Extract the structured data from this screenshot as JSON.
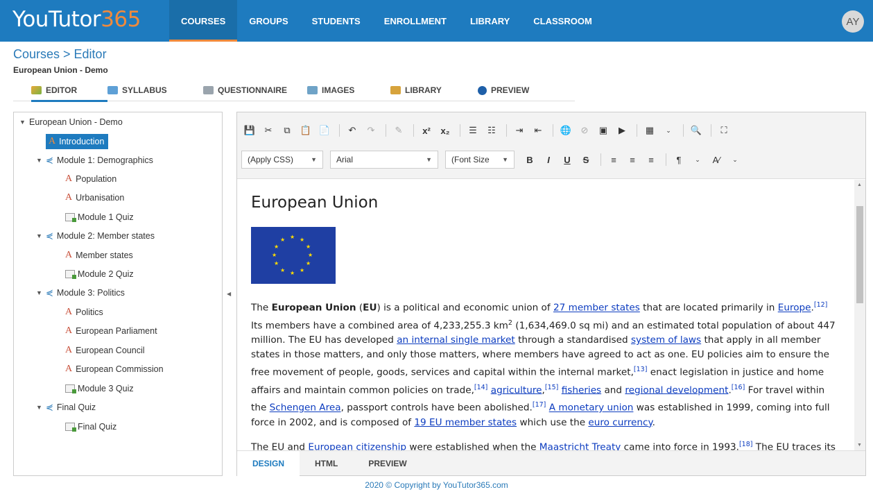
{
  "app": {
    "logo_main": "YouTutor",
    "logo_accent": "365",
    "avatar_initials": "AY"
  },
  "nav": [
    {
      "label": "COURSES"
    },
    {
      "label": "GROUPS"
    },
    {
      "label": "STUDENTS"
    },
    {
      "label": "ENROLLMENT"
    },
    {
      "label": "LIBRARY"
    },
    {
      "label": "CLASSROOM"
    }
  ],
  "breadcrumb": "Courses > Editor",
  "course_title": "European Union - Demo",
  "tabs": [
    {
      "label": "EDITOR",
      "icon": "pencil-icon"
    },
    {
      "label": "SYLLABUS",
      "icon": "tree-icon"
    },
    {
      "label": "QUESTIONNAIRE",
      "icon": "list-icon"
    },
    {
      "label": "IMAGES",
      "icon": "image-icon"
    },
    {
      "label": "LIBRARY",
      "icon": "library-icon"
    },
    {
      "label": "PREVIEW",
      "icon": "info-icon"
    }
  ],
  "tree": [
    {
      "label": "European Union - Demo",
      "type": "root"
    },
    {
      "label": "Introduction",
      "type": "article",
      "selected": true
    },
    {
      "label": "Module 1: Demographics",
      "type": "module"
    },
    {
      "label": "Population",
      "type": "article"
    },
    {
      "label": "Urbanisation",
      "type": "article"
    },
    {
      "label": "Module 1 Quiz",
      "type": "quiz"
    },
    {
      "label": "Module 2: Member states",
      "type": "module"
    },
    {
      "label": "Member states",
      "type": "article"
    },
    {
      "label": "Module 2 Quiz",
      "type": "quiz"
    },
    {
      "label": "Module 3: Politics",
      "type": "module"
    },
    {
      "label": "Politics",
      "type": "article"
    },
    {
      "label": "European Parliament",
      "type": "article"
    },
    {
      "label": "European Council",
      "type": "article"
    },
    {
      "label": "European Commission",
      "type": "article"
    },
    {
      "label": "Module 3 Quiz",
      "type": "quiz"
    },
    {
      "label": "Final Quiz",
      "type": "module"
    },
    {
      "label": "Final Quiz",
      "type": "quiz"
    }
  ],
  "toolbar": {
    "css_select": "(Apply CSS)",
    "font_select": "Arial",
    "size_select": "(Font Size",
    "bold": "B",
    "italic": "I",
    "underline": "U",
    "strike": "S"
  },
  "content": {
    "heading": "European Union",
    "p1": {
      "t1": "The ",
      "b1": "European Union",
      "t2": " (",
      "b2": "EU",
      "t3": ") is a political and economic union of ",
      "l1": "27 member states",
      "t4": " that are located primarily in ",
      "l2": "Europe",
      "t5": ".",
      "s1": "[12]",
      "t6": " Its members have a combined area of 4,233,255.3 km",
      "sup2": "2",
      "t7": " (1,634,469.0 sq mi) and an estimated total population of about 447 million. The EU has developed ",
      "l3": "an internal single market",
      "t8": " through a standardised ",
      "l4": "system of laws",
      "t9": " that apply in all member states in those matters, and only those matters, where members have agreed to act as one. EU policies aim to ensure the free movement of people, goods, services and capital within the internal market,",
      "s2": "[13]",
      "t10": " enact legislation in justice and home affairs and maintain common policies on trade,",
      "s3": "[14]",
      "t11": " ",
      "l5": "agriculture",
      "t12": ",",
      "s4": "[15]",
      "t13": " ",
      "l6": "fisheries",
      "t14": " and ",
      "l7": "regional development",
      "t15": ".",
      "s5": "[16]",
      "t16": " For travel within the ",
      "l8": "Schengen Area",
      "t17": ", passport controls have been abolished.",
      "s6": "[17]",
      "t18": " ",
      "l9": "A monetary union",
      "t19": " was established in 1999, coming into full force in 2002, and is composed of ",
      "l10": "19 EU member states",
      "t20": " which use the ",
      "l11": "euro currency",
      "t21": "."
    },
    "p2": {
      "t1": "The EU and ",
      "l1": "European citizenship",
      "t2": " were established when the ",
      "l2": "Maastricht Treaty",
      "t3": " came into force in 1993.",
      "s1": "[18]",
      "t4": " The EU traces its"
    }
  },
  "modes": [
    {
      "label": "DESIGN"
    },
    {
      "label": "HTML"
    },
    {
      "label": "PREVIEW"
    }
  ],
  "footer": "2020 © Copyright by YouTutor365.com",
  "colors": {
    "brand": "#1e7bbf",
    "accent": "#f08a3c",
    "flag": "#1f3fa3",
    "flag_star": "#ffdd00"
  }
}
